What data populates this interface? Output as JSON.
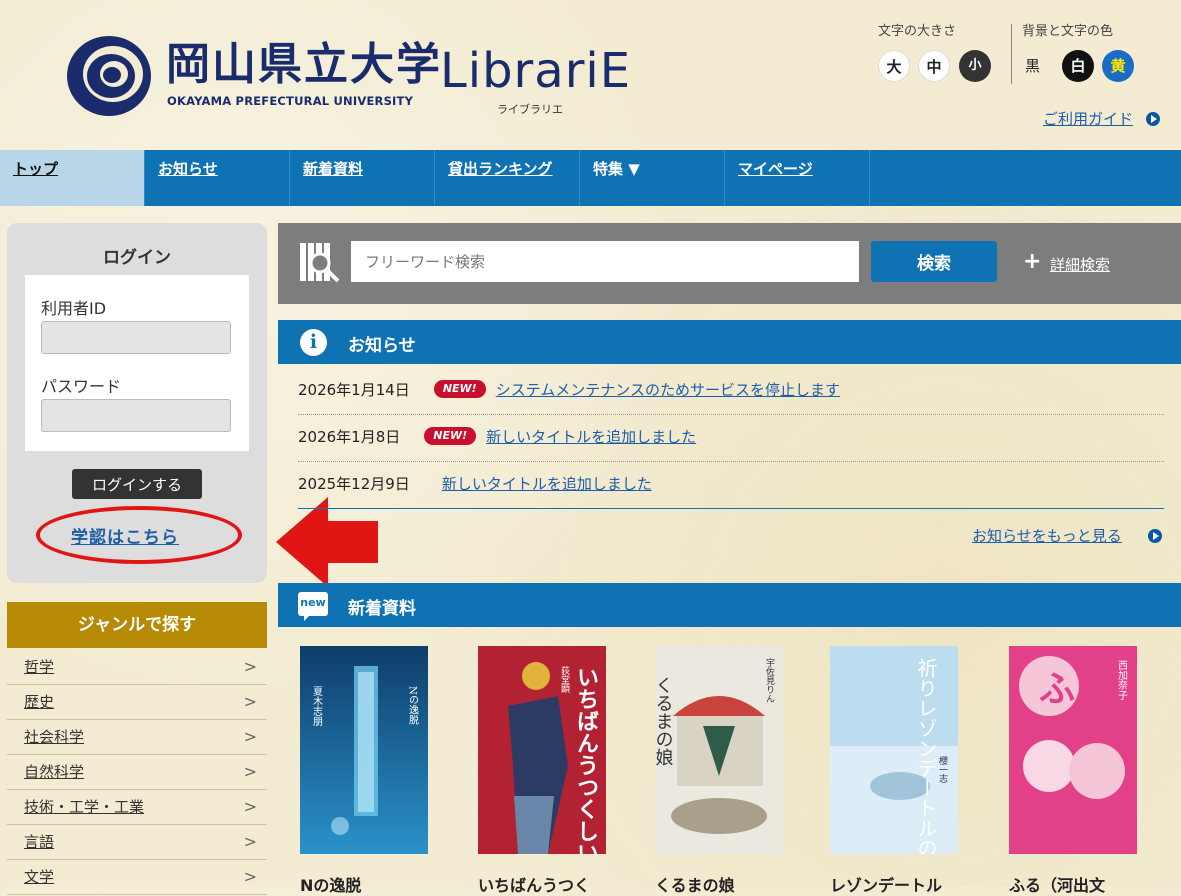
{
  "header": {
    "logo_jp": "岡山県立大学",
    "logo_en": "OKAYAMA PREFECTURAL UNIVERSITY",
    "logo_lib": "LibrariE",
    "logo_lib_kana": "ライブラリエ",
    "font_size_label": "文字の大きさ",
    "font_size_options": [
      "大",
      "中",
      "小"
    ],
    "color_label": "背景と文字の色",
    "color_options": [
      "黒",
      "白",
      "黄"
    ],
    "guide_link": "ご利用ガイド"
  },
  "nav": {
    "items": [
      {
        "label": "トップ"
      },
      {
        "label": "お知らせ"
      },
      {
        "label": "新着資料"
      },
      {
        "label": "貸出ランキング"
      },
      {
        "label": "特集 ▼"
      },
      {
        "label": "マイページ"
      }
    ]
  },
  "login": {
    "title": "ログイン",
    "user_id_label": "利用者ID",
    "password_label": "パスワード",
    "button": "ログインする",
    "gakunin_link": "学認はこちら"
  },
  "genre": {
    "title": "ジャンルで探す",
    "items": [
      "哲学",
      "歴史",
      "社会科学",
      "自然科学",
      "技術・工学・工業",
      "言語",
      "文学"
    ]
  },
  "search": {
    "placeholder": "フリーワード検索",
    "button": "検索",
    "advanced": "詳細検索"
  },
  "notices": {
    "title": "お知らせ",
    "new_badge": "NEW!",
    "items": [
      {
        "date": "2026年1月14日",
        "text": "システムメンテナンスのためサービスを停止します"
      },
      {
        "date": "2026年1月8日",
        "text": "新しいタイトルを追加しました"
      },
      {
        "date": "2025年12月9日",
        "text": "新しいタイトルを追加しました"
      }
    ],
    "more": "お知らせをもっと見る"
  },
  "new_arrivals": {
    "icon_text": "new",
    "title": "新着資料",
    "books": [
      {
        "title": "Nの逸脱",
        "cover_title": "Nの逸脱",
        "cover_author": "夏木志朋"
      },
      {
        "title": "いちばんうつく",
        "cover_title": "いちばんうつくしい王冠",
        "cover_author": "荻堂顕"
      },
      {
        "title": "くるまの娘",
        "cover_title": "くるまの娘",
        "cover_author": "宇佐見りん"
      },
      {
        "title": "レゾンデートル",
        "cover_title": "祈りレゾンデートルの",
        "cover_author": "櫻一志"
      },
      {
        "title": "ふる（河出文",
        "cover_title": "ふる",
        "cover_author": "西加奈子"
      }
    ]
  },
  "colors": {
    "nav_blue": "#0f72b3",
    "genre_gold": "#b68a05",
    "highlight_red": "#e21515",
    "logo_navy": "#1a2c6b"
  }
}
